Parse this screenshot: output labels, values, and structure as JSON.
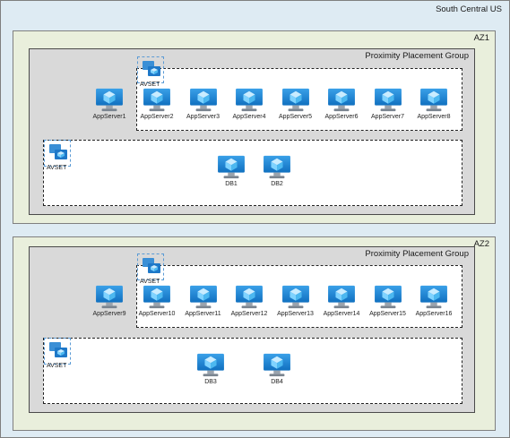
{
  "region": {
    "label": "South Central US"
  },
  "zones": [
    {
      "label": "AZ1",
      "ppg_label": "Proximity Placement Group",
      "app_set_label": "AVSET",
      "db_set_label": "AVSET",
      "standalone": "AppServer1",
      "app_servers": [
        "AppServer2",
        "AppServer3",
        "AppServer4",
        "AppServer5",
        "AppServer6",
        "AppServer7",
        "AppServer8"
      ],
      "db_servers": [
        "DB1",
        "DB2"
      ]
    },
    {
      "label": "AZ2",
      "ppg_label": "Proximity Placement Group",
      "app_set_label": "AVSET",
      "db_set_label": "AVSET",
      "standalone": "AppServer9",
      "app_servers": [
        "AppServer10",
        "AppServer11",
        "AppServer12",
        "AppServer13",
        "AppServer14",
        "AppServer15",
        "AppServer16"
      ],
      "db_servers": [
        "DB3",
        "DB4"
      ]
    }
  ],
  "icons": {
    "vm": "virtual-machine-icon",
    "avset": "availability-set-icon"
  },
  "colors": {
    "region_bg": "#deebf3",
    "zone_bg": "#e9efdc",
    "ppg_bg": "#d9d9d9",
    "vm_blue": "#1e90d8",
    "avset_border": "#5b9bd5"
  }
}
